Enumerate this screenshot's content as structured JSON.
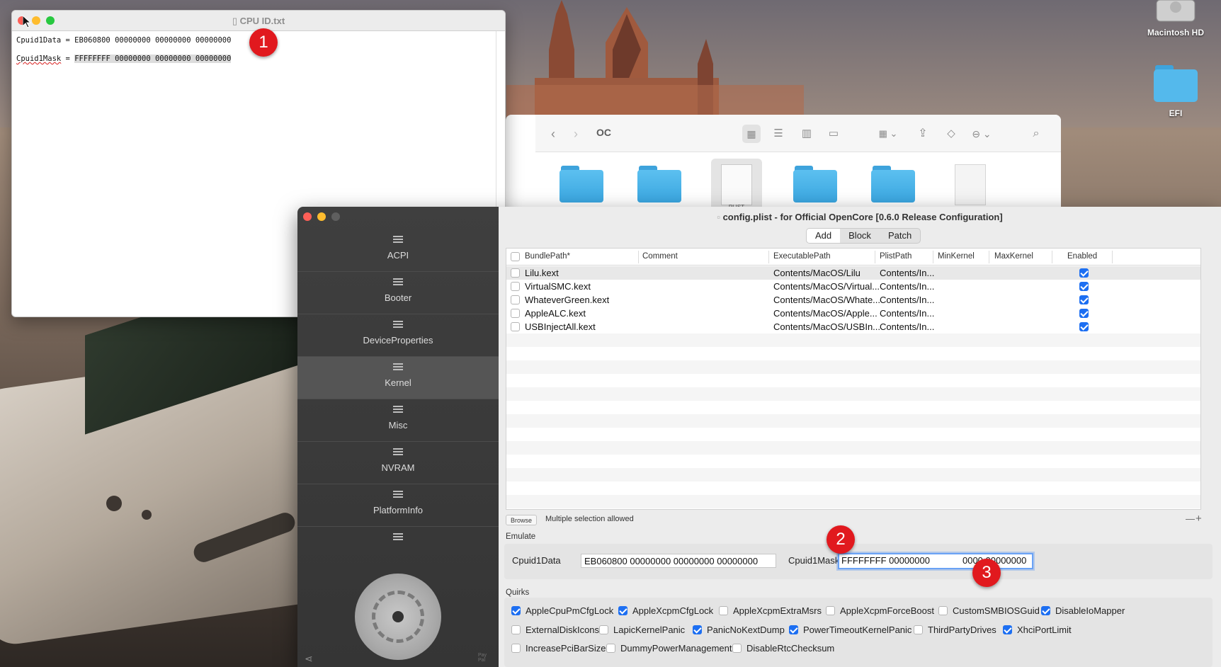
{
  "textedit": {
    "title": "CPU ID.txt",
    "line1_key": "Cpuid1Data",
    "line1_rest": " = EB060800 00000000 00000000 00000000",
    "line2_key": "Cpuid1Mask",
    "line2_eq": " = ",
    "line2_value": "FFFFFFFF 00000000 00000000 00000000"
  },
  "desktop": {
    "icons": [
      {
        "label": "Macintosh HD"
      },
      {
        "label": "EFI"
      }
    ]
  },
  "finder": {
    "title": "OC",
    "plist_label": "PLIST"
  },
  "app": {
    "window_title": "config.plist - for Official OpenCore [0.6.0 Release Configuration]",
    "sidebar": [
      {
        "label": "ACPI"
      },
      {
        "label": "Booter"
      },
      {
        "label": "DeviceProperties"
      },
      {
        "label": "Kernel"
      },
      {
        "label": "Misc"
      },
      {
        "label": "NVRAM"
      },
      {
        "label": "PlatformInfo"
      }
    ],
    "sidebar_footer": "Pay Pal",
    "tabs": [
      "Add",
      "Block",
      "Patch"
    ],
    "table": {
      "columns": [
        "BundlePath*",
        "Comment",
        "ExecutablePath",
        "PlistPath",
        "MinKernel",
        "MaxKernel",
        "Enabled"
      ],
      "rows": [
        {
          "bundle": "Lilu.kext",
          "comment": "",
          "exec": "Contents/MacOS/Lilu",
          "plist": "Contents/In...",
          "enabled": true
        },
        {
          "bundle": "VirtualSMC.kext",
          "comment": "",
          "exec": "Contents/MacOS/Virtual...",
          "plist": "Contents/In...",
          "enabled": true
        },
        {
          "bundle": "WhateverGreen.kext",
          "comment": "",
          "exec": "Contents/MacOS/Whate...",
          "plist": "Contents/In...",
          "enabled": true
        },
        {
          "bundle": "AppleALC.kext",
          "comment": "",
          "exec": "Contents/MacOS/Apple...",
          "plist": "Contents/In...",
          "enabled": true
        },
        {
          "bundle": "USBInjectAll.kext",
          "comment": "",
          "exec": "Contents/MacOS/USBIn...",
          "plist": "Contents/In...",
          "enabled": true
        }
      ]
    },
    "footer": {
      "browse": "Browse",
      "note": "Multiple selection allowed",
      "minus": "—",
      "plus": "+"
    },
    "emulate": {
      "section": "Emulate",
      "data_label": "Cpuid1Data",
      "data_value": "EB060800 00000000 00000000 00000000",
      "mask_label": "Cpuid1Mask",
      "mask_value_a": "FFFFFFFF 00000000",
      "mask_value_b": "0000 00000000"
    },
    "quirks": {
      "section": "Quirks",
      "items": [
        {
          "label": "AppleCpuPmCfgLock",
          "checked": true
        },
        {
          "label": "AppleXcpmCfgLock",
          "checked": true
        },
        {
          "label": "AppleXcpmExtraMsrs",
          "checked": false
        },
        {
          "label": "AppleXcpmForceBoost",
          "checked": false
        },
        {
          "label": "CustomSMBIOSGuid",
          "checked": false
        },
        {
          "label": "DisableIoMapper",
          "checked": true
        },
        {
          "label": "ExternalDiskIcons",
          "checked": false
        },
        {
          "label": "LapicKernelPanic",
          "checked": false
        },
        {
          "label": "PanicNoKextDump",
          "checked": true
        },
        {
          "label": "PowerTimeoutKernelPanic",
          "checked": true
        },
        {
          "label": "ThirdPartyDrives",
          "checked": false
        },
        {
          "label": "XhciPortLimit",
          "checked": true
        },
        {
          "label": "IncreasePciBarSize",
          "checked": false
        },
        {
          "label": "DummyPowerManagement",
          "checked": false
        },
        {
          "label": "DisableRtcChecksum",
          "checked": false
        }
      ]
    }
  },
  "annotations": [
    "1",
    "2",
    "3"
  ],
  "colors": {
    "accent": "#1d6ff2",
    "badge": "#e1191e",
    "close": "#fe5f57",
    "minimize": "#febc2e",
    "zoom": "#28c840"
  }
}
